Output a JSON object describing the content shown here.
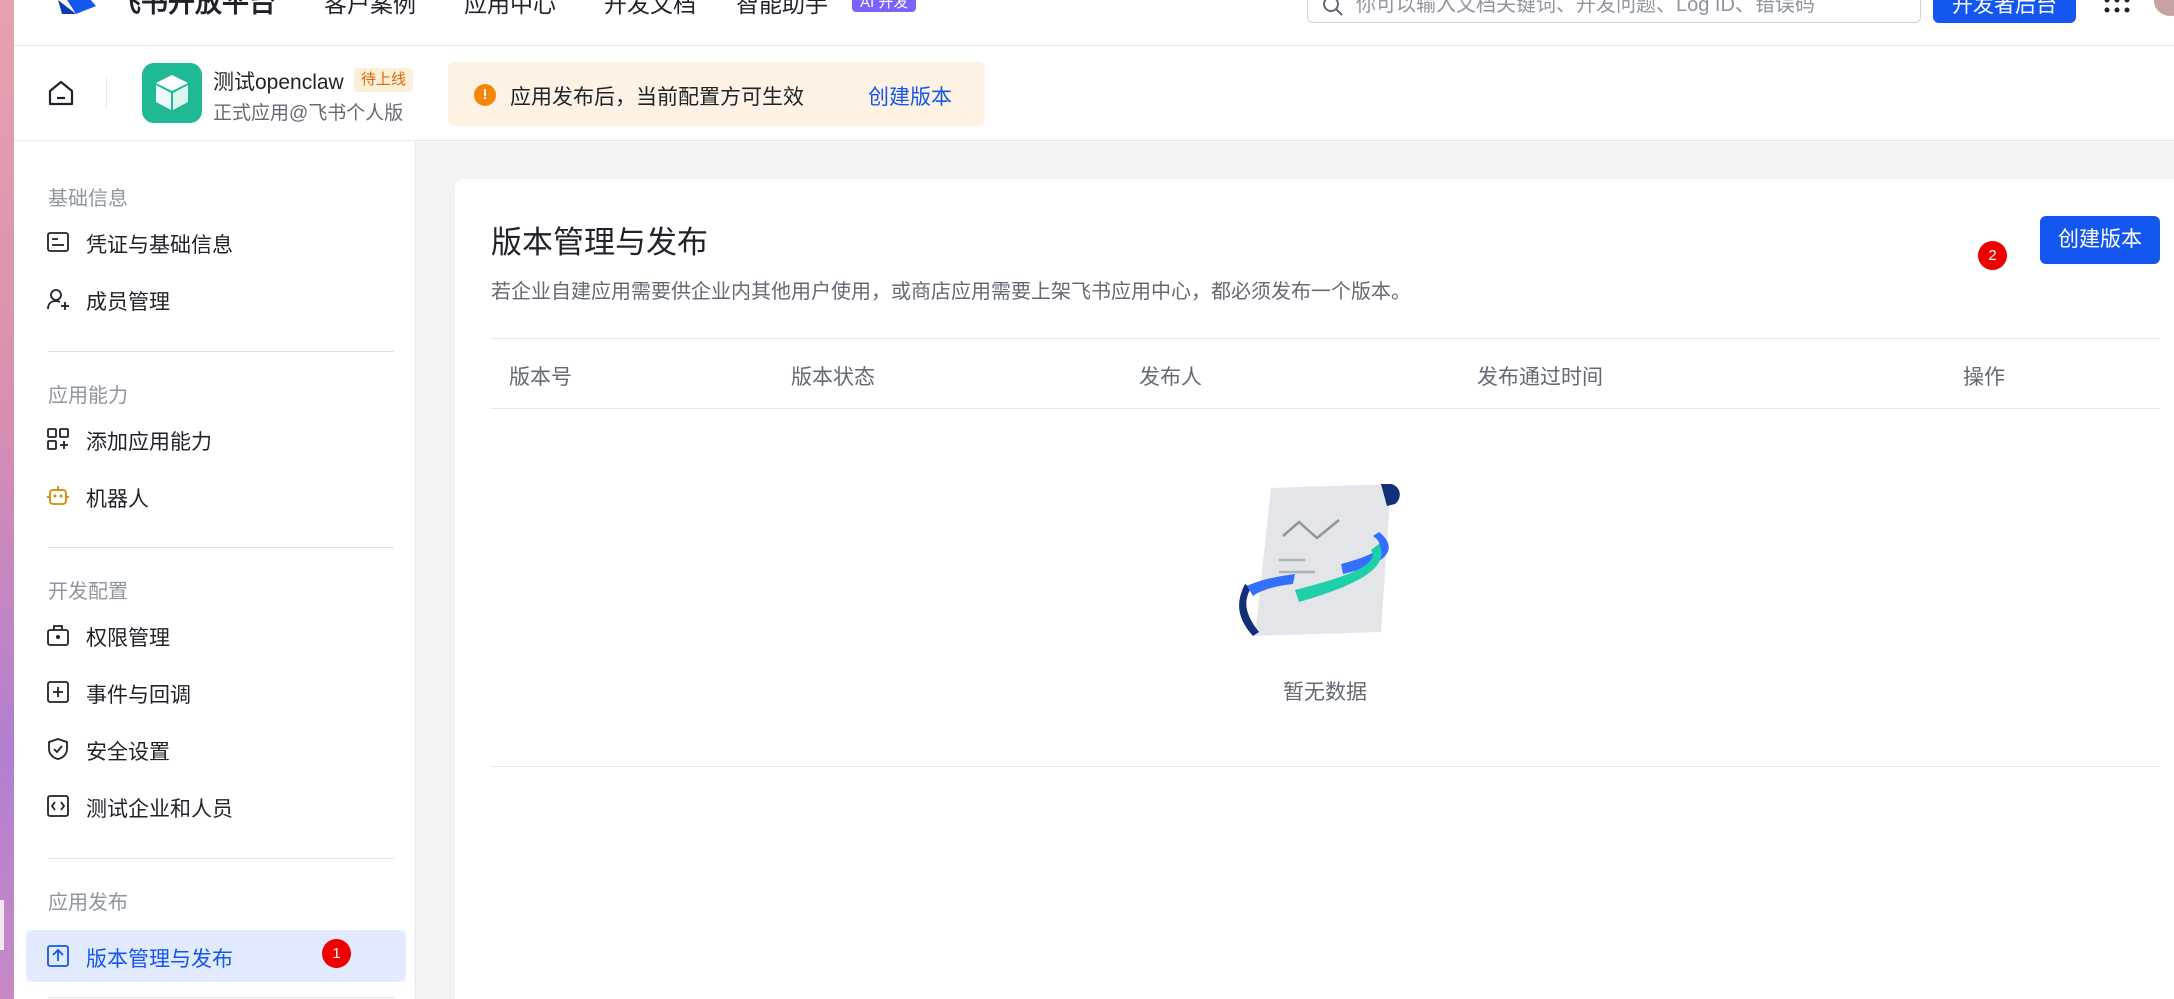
{
  "topnav": {
    "brand": "飞书开放平台",
    "items": [
      "客户案例",
      "应用中心",
      "开发文档",
      "智能助手"
    ],
    "ai_badge": "AI 开发",
    "search_placeholder": "你可以输入文档关键词、开发问题、Log ID、错误码",
    "dev_button": "开发者后台"
  },
  "app": {
    "name": "测试openclaw",
    "status_tag": "待上线",
    "subtitle": "正式应用@飞书个人版",
    "notice": "应用发布后，当前配置方可生效",
    "notice_link": "创建版本"
  },
  "sidebar": {
    "sections": [
      {
        "title": "基础信息",
        "items": [
          {
            "label": "凭证与基础信息",
            "icon": "credential-icon"
          },
          {
            "label": "成员管理",
            "icon": "member-add-icon"
          }
        ]
      },
      {
        "title": "应用能力",
        "items": [
          {
            "label": "添加应用能力",
            "icon": "apps-grid-icon"
          },
          {
            "label": "机器人",
            "icon": "robot-icon"
          }
        ]
      },
      {
        "title": "开发配置",
        "items": [
          {
            "label": "权限管理",
            "icon": "permission-icon"
          },
          {
            "label": "事件与回调",
            "icon": "event-plus-icon"
          },
          {
            "label": "安全设置",
            "icon": "shield-icon"
          },
          {
            "label": "测试企业和人员",
            "icon": "code-icon"
          }
        ]
      },
      {
        "title": "应用发布",
        "items": [
          {
            "label": "版本管理与发布",
            "icon": "upload-icon",
            "active": true
          }
        ]
      }
    ]
  },
  "badges": {
    "first": "1",
    "second": "2"
  },
  "main": {
    "title": "版本管理与发布",
    "description": "若企业自建应用需要供企业内其他用户使用，或商店应用需要上架飞书应用中心，都必须发布一个版本。",
    "create_button": "创建版本",
    "columns": [
      "版本号",
      "版本状态",
      "发布人",
      "发布通过时间",
      "操作"
    ],
    "empty_text": "暂无数据"
  },
  "colors": {
    "primary": "#1456f0",
    "app_icon": "#1fb996",
    "warning": "#f5860a",
    "badge": "#ee0000",
    "active_bg": "#e1eaff"
  }
}
